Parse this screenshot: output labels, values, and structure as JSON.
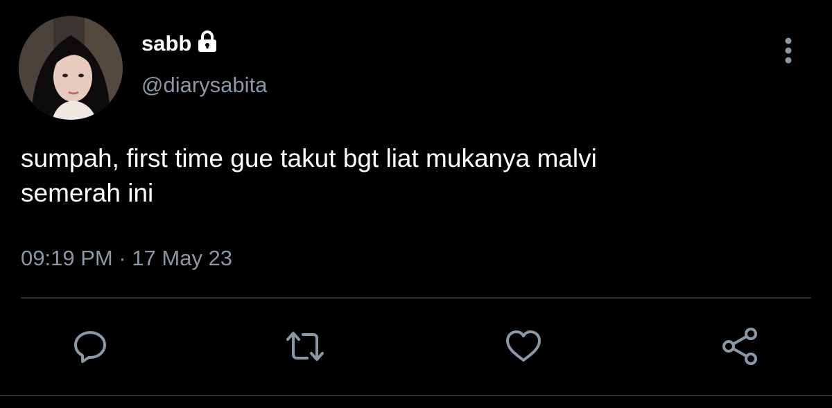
{
  "user": {
    "display_name": "sabb",
    "handle": "@diarysabita",
    "avatar_icon": "profile-photo",
    "protected_icon": "lock-icon"
  },
  "tweet": {
    "text_lines": [
      "sumpah, first time gue takut bgt liat mukanya malvi",
      "semerah ini"
    ],
    "time": "09:19 PM",
    "separator": "·",
    "date": "17 May 23"
  },
  "actions": {
    "more": "more-vertical-icon",
    "reply": "reply-icon",
    "retweet": "retweet-icon",
    "like": "heart-icon",
    "share": "share-icon"
  },
  "colors": {
    "background": "#000000",
    "primary_text": "#ffffff",
    "secondary_text": "#8b98a5",
    "divider": "#2f3336"
  }
}
